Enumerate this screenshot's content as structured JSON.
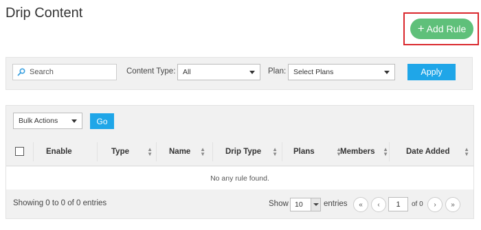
{
  "page": {
    "title": "Drip Content"
  },
  "header": {
    "add_rule_label": "Add Rule",
    "add_rule_icon": "plus-icon",
    "highlight_color": "#d9262b",
    "accent_color": "#5fc07a"
  },
  "filters": {
    "search_placeholder": "Search",
    "content_type_label": "Content Type:",
    "content_type_value": "All",
    "plan_label": "Plan:",
    "plan_value": "Select Plans",
    "apply_label": "Apply",
    "apply_color": "#1fa6e8"
  },
  "bulk": {
    "value": "Bulk Actions",
    "go_label": "Go"
  },
  "table": {
    "columns": [
      "Enable",
      "Type",
      "Name",
      "Drip Type",
      "Plans",
      "Members",
      "Date Added"
    ],
    "empty_message": "No any rule found."
  },
  "footer": {
    "showing": "Showing 0 to 0 of 0 entries",
    "show_label": "Show",
    "page_size": "10",
    "entries_label": "entries",
    "current_page": "1",
    "of_pages": "of 0"
  }
}
